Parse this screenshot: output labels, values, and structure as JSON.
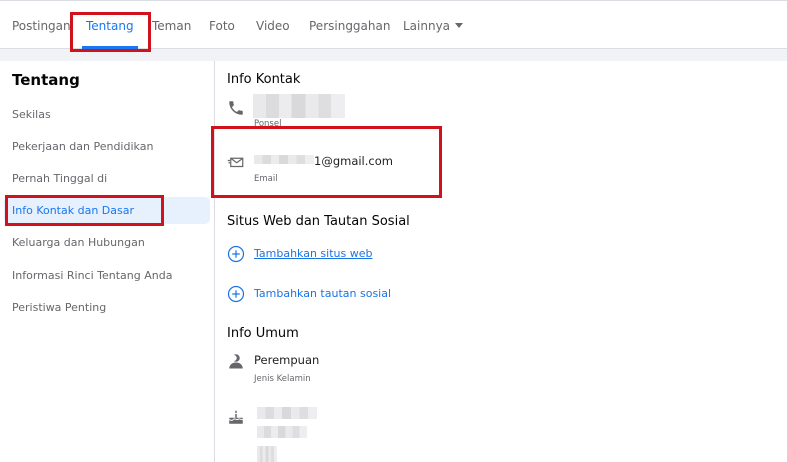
{
  "tabs": [
    {
      "label": "Postingan",
      "active": false
    },
    {
      "label": "Tentang",
      "active": true
    },
    {
      "label": "Teman",
      "active": false
    },
    {
      "label": "Foto",
      "active": false
    },
    {
      "label": "Video",
      "active": false
    },
    {
      "label": "Persinggahan",
      "active": false
    },
    {
      "label": "Lainnya",
      "active": false
    }
  ],
  "sidebar": {
    "title": "Tentang",
    "items": [
      {
        "label": "Sekilas",
        "active": false
      },
      {
        "label": "Pekerjaan dan Pendidikan",
        "active": false
      },
      {
        "label": "Pernah Tinggal di",
        "active": false
      },
      {
        "label": "Info Kontak dan Dasar",
        "active": true
      },
      {
        "label": "Keluarga dan Hubungan",
        "active": false
      },
      {
        "label": "Informasi Rinci Tentang Anda",
        "active": false
      },
      {
        "label": "Peristiwa Penting",
        "active": false
      }
    ]
  },
  "contact": {
    "title": "Info Kontak",
    "phone_label": "Ponsel",
    "email_value": "1@gmail.com",
    "email_label": "Email"
  },
  "websites": {
    "title": "Situs Web dan Tautan Sosial",
    "add_website": "Tambahkan situs web",
    "add_social": "Tambahkan tautan sosial"
  },
  "general": {
    "title": "Info Umum",
    "gender_value": "Perempuan",
    "gender_label": "Jenis Kelamin"
  },
  "colors": {
    "accent": "#1877f2",
    "highlight_box": "#d0121d",
    "active_bg": "#e7f0fd"
  }
}
